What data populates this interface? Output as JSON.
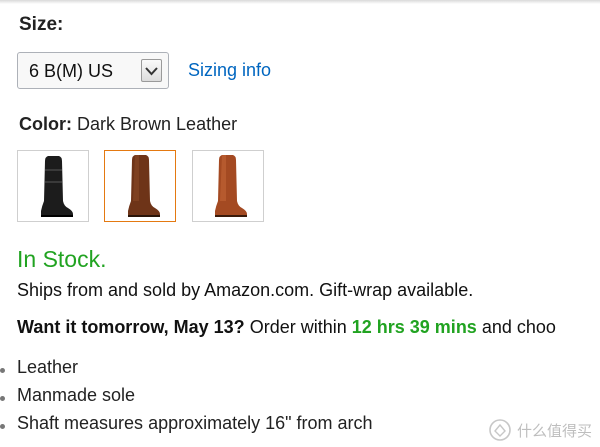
{
  "size": {
    "label": "Size:",
    "selected": "6 B(M) US",
    "sizing_link": "Sizing info"
  },
  "color": {
    "label": "Color:",
    "value": "Dark Brown Leather",
    "swatches": [
      {
        "name": "black",
        "selected": false
      },
      {
        "name": "dark-brown",
        "selected": true
      },
      {
        "name": "light-brown",
        "selected": false
      }
    ]
  },
  "availability": {
    "status": "In Stock.",
    "ships": "Ships from and sold by Amazon.com. Gift-wrap available."
  },
  "delivery": {
    "title": "Want it tomorrow, May 13?",
    "order_within": "Order within",
    "countdown": "12 hrs 39 mins",
    "tail": "and choo"
  },
  "features": [
    "Leather",
    "Manmade sole",
    "Shaft measures approximately 16\" from arch"
  ],
  "watermark": {
    "text": "什么值得买"
  },
  "colors": {
    "in_stock_green": "#21a321",
    "link_blue": "#0066c0",
    "selected_swatch_border": "#e47911"
  }
}
